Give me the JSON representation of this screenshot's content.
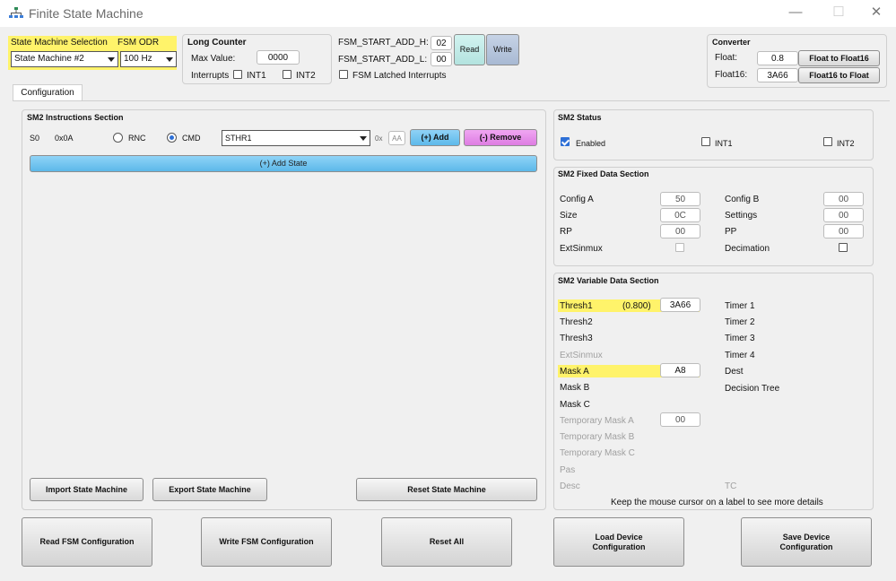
{
  "window": {
    "title": "Finite State Machine",
    "minimize": "—",
    "maximize": "☐",
    "close": "✕"
  },
  "top": {
    "sm_selection_label": "State Machine Selection",
    "fsm_odr_label": "FSM ODR",
    "sm_selected": "State Machine #2",
    "odr_selected": "100 Hz",
    "long_counter": {
      "title": "Long Counter",
      "max_value_label": "Max Value:",
      "max_value": "0000",
      "interrupts_label": "Interrupts",
      "int1": "INT1",
      "int2": "INT2"
    },
    "fsm_start_h_label": "FSM_START_ADD_H:",
    "fsm_start_h": "02",
    "fsm_start_l_label": "FSM_START_ADD_L:",
    "fsm_start_l": "00",
    "read": "Read",
    "write": "Write",
    "latched_label": "FSM Latched Interrupts",
    "converter": {
      "title": "Converter",
      "float_label": "Float:",
      "float_value": "0.8",
      "float_btn": "Float to Float16",
      "float16_label": "Float16:",
      "float16_value": "3A66",
      "float16_btn": "Float16 to Float"
    }
  },
  "tab": {
    "label": "Configuration"
  },
  "instructions": {
    "title": "SM2 Instructions Section",
    "row": {
      "index": "S0",
      "addr": "0x0A",
      "rnc": "RNC",
      "cmd": "CMD",
      "select": "STHR1",
      "hex_prefix": "0x",
      "hex_value": "AA",
      "add": "(+) Add",
      "remove": "(-) Remove"
    },
    "add_state": "(+) Add State",
    "import": "Import State Machine",
    "export": "Export State Machine",
    "reset": "Reset State Machine"
  },
  "status": {
    "title": "SM2 Status",
    "enabled": "Enabled",
    "int1": "INT1",
    "int2": "INT2"
  },
  "fixed": {
    "title": "SM2 Fixed Data Section",
    "left": [
      {
        "label": "Config A",
        "value": "50"
      },
      {
        "label": "Size",
        "value": "0C"
      },
      {
        "label": "RP",
        "value": "00"
      },
      {
        "label": "ExtSinmux",
        "value": ""
      }
    ],
    "right": [
      {
        "label": "Config B",
        "value": "00"
      },
      {
        "label": "Settings",
        "value": "00"
      },
      {
        "label": "PP",
        "value": "00"
      },
      {
        "label": "Decimation",
        "value": ""
      }
    ]
  },
  "variable": {
    "title": "SM2 Variable Data Section",
    "thresh1": "Thresh1",
    "thresh1_float": "(0.800)",
    "thresh1_value": "3A66",
    "thresh2": "Thresh2",
    "thresh3": "Thresh3",
    "ext": "ExtSinmux",
    "mask_a": "Mask A",
    "mask_a_value": "A8",
    "mask_b": "Mask B",
    "mask_c": "Mask C",
    "tmask_a": "Temporary Mask A",
    "tmask_a_value": "00",
    "tmask_b": "Temporary Mask B",
    "tmask_c": "Temporary Mask C",
    "pas": "Pas",
    "desc": "Desc",
    "timer1": "Timer 1",
    "timer2": "Timer 2",
    "timer3": "Timer 3",
    "timer4": "Timer 4",
    "dest": "Dest",
    "decision": "Decision Tree",
    "tc": "TC",
    "hint": "Keep the mouse cursor on a label to see more details"
  },
  "bottom": {
    "read_fsm": "Read FSM Configuration",
    "write_fsm": "Write FSM Configuration",
    "reset_all": "Reset All",
    "load_device": "Load Device Configuration",
    "save_device": "Save Device Configuration"
  }
}
